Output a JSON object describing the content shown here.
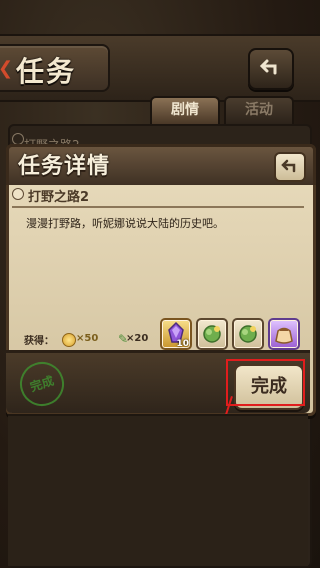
{
  "screen": {
    "title": "任务",
    "tabs": [
      {
        "label": "剧情"
      },
      {
        "label": "活动"
      }
    ],
    "background_list_item": "打野之路2"
  },
  "modal": {
    "title": "任务详情",
    "quest": {
      "name": "打野之路2",
      "description": "漫漫打野路，听妮娜说说大陆的历史吧。"
    },
    "rewards": {
      "label": "获得：",
      "coin": "×50",
      "exp": "×20",
      "items": [
        {
          "count": "10",
          "icon": "purple-crystal-icon"
        },
        {
          "count": "",
          "icon": "green-herb-icon"
        },
        {
          "count": "",
          "icon": "green-herb-icon"
        },
        {
          "count": "",
          "icon": "purple-pouch-icon"
        }
      ]
    },
    "stamp": "完成",
    "complete_button": "完成"
  },
  "colors": {
    "accent": "#e11d1d",
    "parchment": "#e9dcbd",
    "wood": "#4a3622",
    "green_stamp": "#3f8d2f"
  }
}
